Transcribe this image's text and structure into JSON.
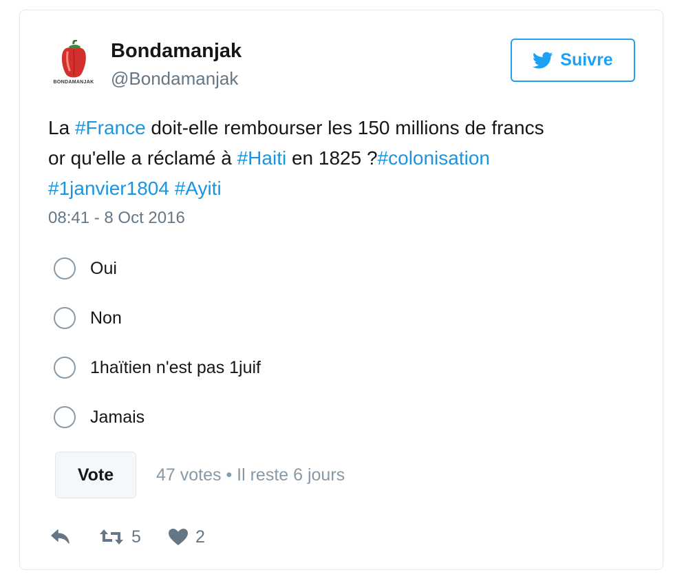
{
  "author": {
    "display_name": "Bondamanjak",
    "handle": "@Bondamanjak",
    "avatar_brand": "BONDAMANJAK",
    "avatar_icon": "red-pepper-icon"
  },
  "follow_button": {
    "label": "Suivre",
    "icon": "twitter-bird-icon"
  },
  "tweet": {
    "segments": [
      "La ",
      "#France",
      " doit-elle rembourser les 150 millions de francs",
      "or qu'elle a réclamé à ",
      "#Haiti",
      " en 1825 ?",
      "#colonisation",
      "#1janvier1804",
      " ",
      "#Ayiti"
    ],
    "timestamp": "08:41 - 8 Oct 2016"
  },
  "poll": {
    "options": [
      "Oui",
      "Non",
      "1haïtien n'est pas 1juif",
      "Jamais"
    ],
    "vote_label": "Vote",
    "meta": "47 votes • Il reste 6 jours"
  },
  "actions": {
    "reply": {
      "icon": "reply-icon"
    },
    "retweet": {
      "icon": "retweet-icon",
      "count": "5"
    },
    "like": {
      "icon": "heart-icon",
      "count": "2"
    }
  },
  "colors": {
    "accent": "#1da1f2",
    "hashtag": "#1b95e0",
    "secondary_text": "#657786",
    "border": "#e1e8ed"
  }
}
